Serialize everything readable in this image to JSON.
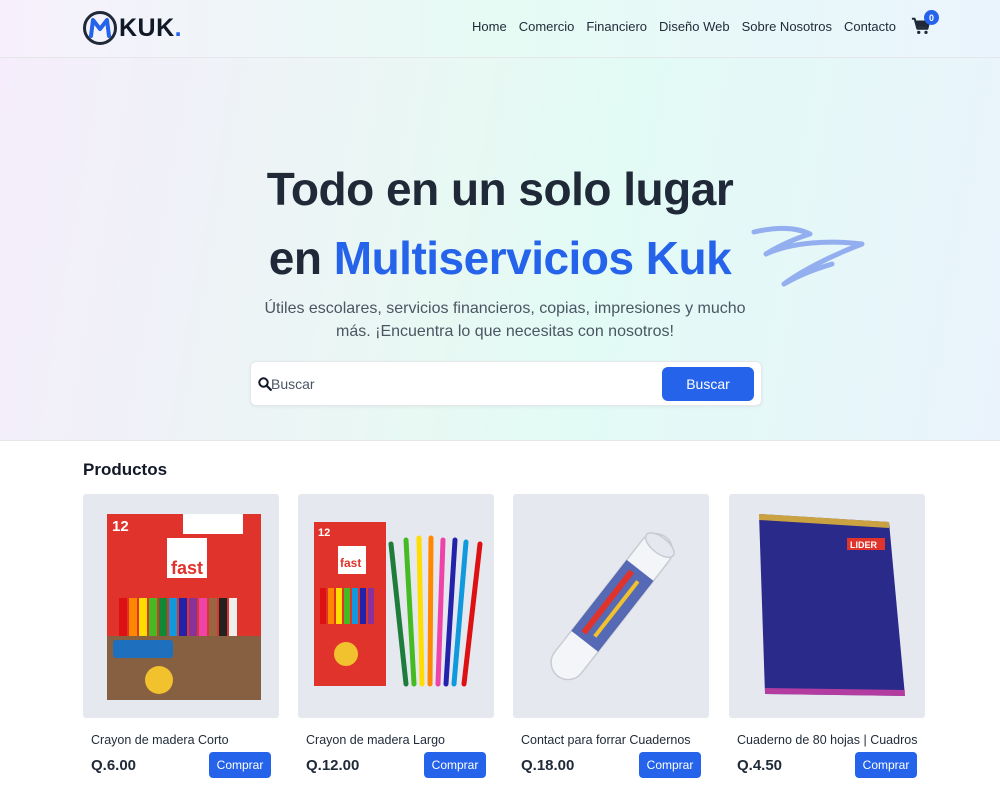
{
  "header": {
    "logo_text": "KUK",
    "logo_dot": ".",
    "nav": [
      "Home",
      "Comercio",
      "Financiero",
      "Diseño Web",
      "Sobre Nosotros",
      "Contacto"
    ],
    "cart_count": "0"
  },
  "hero": {
    "title_line1": "Todo en un solo lugar",
    "title_line2_prefix": "en",
    "title_line2_accent": "Multiservicios Kuk",
    "subtitle": "Útiles escolares, servicios financieros, copias, impresiones y mucho más. ¡Encuentra lo que necesitas con nosotros!",
    "search_placeholder": "Buscar",
    "search_button": "Buscar"
  },
  "products": {
    "title": "Productos",
    "items": [
      {
        "name": "Crayon de madera Corto",
        "price": "Q.6.00",
        "button": "Comprar",
        "image_icon": "short-colored-pencils-box"
      },
      {
        "name": "Crayon de madera Largo",
        "price": "Q.12.00",
        "button": "Comprar",
        "image_icon": "long-colored-pencils-box"
      },
      {
        "name": "Contact para forrar Cuadernos",
        "price": "Q.18.00",
        "button": "Comprar",
        "image_icon": "contact-paper-roll"
      },
      {
        "name": "Cuaderno de 80 hojas | Cuadros",
        "price": "Q.4.50",
        "button": "Comprar",
        "image_icon": "blue-notebook"
      }
    ]
  },
  "colors": {
    "accent": "#2563eb",
    "text": "#1f2937"
  }
}
